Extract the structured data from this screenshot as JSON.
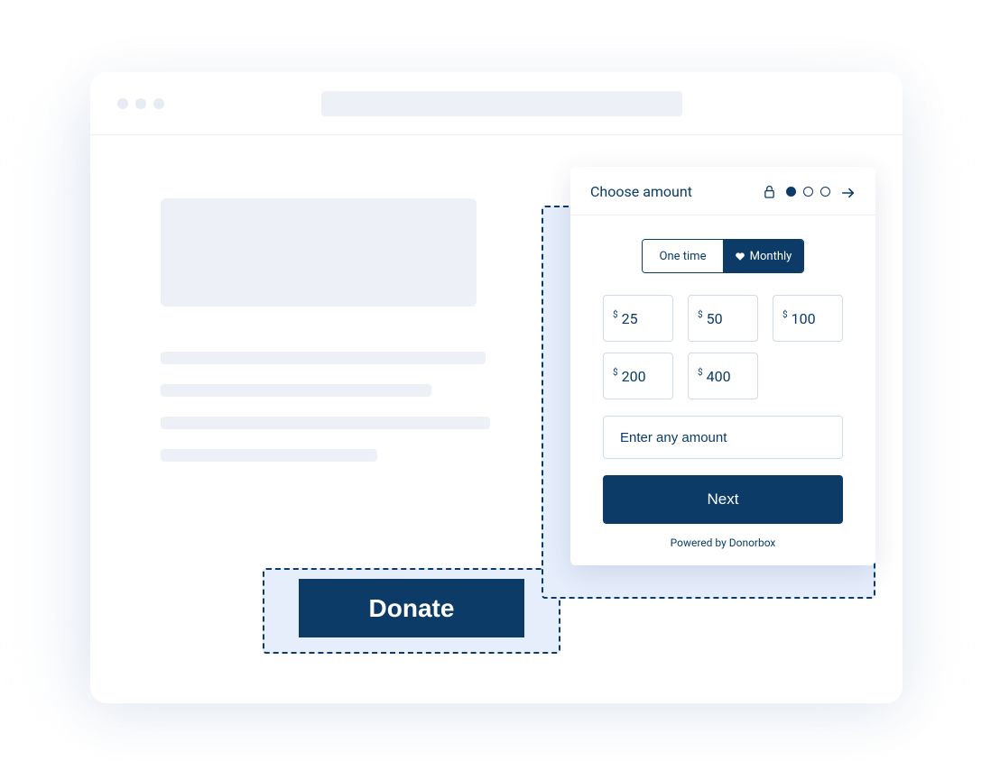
{
  "popup": {
    "donate_label": "Donate"
  },
  "widget": {
    "title": "Choose amount",
    "frequency": {
      "onetime": "One time",
      "monthly": "Monthly"
    },
    "currency_symbol": "$",
    "amounts": [
      "25",
      "50",
      "100",
      "200",
      "400"
    ],
    "custom_placeholder": "Enter any amount",
    "next_label": "Next",
    "powered_by": "Powered by Donorbox"
  }
}
